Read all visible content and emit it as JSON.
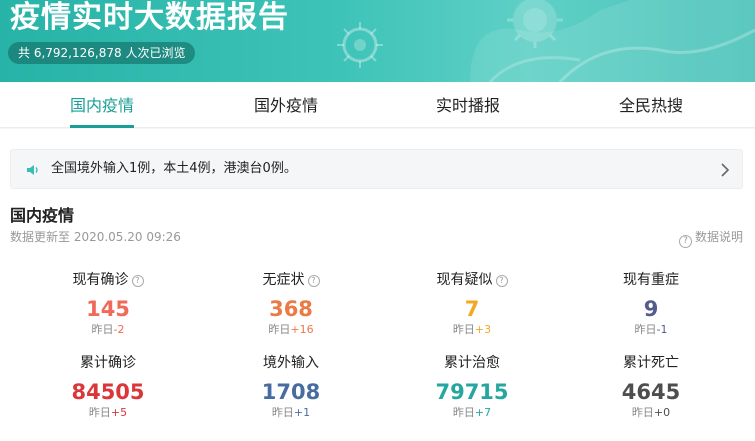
{
  "banner": {
    "title": "疫情实时大数据报告",
    "view_prefix": "共 ",
    "view_count": "6,792,126,878",
    "view_suffix": " 人次已浏览"
  },
  "tabs": [
    {
      "label": "国内疫情",
      "active": true
    },
    {
      "label": "国外疫情",
      "active": false
    },
    {
      "label": "实时播报",
      "active": false
    },
    {
      "label": "全民热搜",
      "active": false
    }
  ],
  "notice": {
    "icon": "speaker-icon",
    "text": "全国境外输入1例，本土4例，港澳台0例。"
  },
  "section": {
    "title": "国内疫情",
    "updated": "数据更新至 2020.05.20 09:26",
    "data_note": "数据说明"
  },
  "stats": [
    {
      "label": "现有确诊",
      "help": true,
      "value": "145",
      "delta_prefix": "昨日",
      "delta": "-2",
      "color": "#f06a5a",
      "delta_color": "#f06a5a"
    },
    {
      "label": "无症状",
      "help": true,
      "value": "368",
      "delta_prefix": "昨日",
      "delta": "+16",
      "color": "#ec7a45",
      "delta_color": "#ec7a45"
    },
    {
      "label": "现有疑似",
      "help": true,
      "value": "7",
      "delta_prefix": "昨日",
      "delta": "+3",
      "color": "#f5a623",
      "delta_color": "#f5a623"
    },
    {
      "label": "现有重症",
      "help": false,
      "value": "9",
      "delta_prefix": "昨日",
      "delta": "-1",
      "color": "#555b8c",
      "delta_color": "#555b8c"
    },
    {
      "label": "累计确诊",
      "help": false,
      "value": "84505",
      "delta_prefix": "昨日",
      "delta": "+5",
      "color": "#d9373a",
      "delta_color": "#d9373a"
    },
    {
      "label": "境外输入",
      "help": false,
      "value": "1708",
      "delta_prefix": "昨日",
      "delta": "+1",
      "color": "#476da0",
      "delta_color": "#476da0"
    },
    {
      "label": "累计治愈",
      "help": false,
      "value": "79715",
      "delta_prefix": "昨日",
      "delta": "+7",
      "color": "#25a6a0",
      "delta_color": "#25a6a0"
    },
    {
      "label": "累计死亡",
      "help": false,
      "value": "4645",
      "delta_prefix": "昨日",
      "delta": "+0",
      "color": "#4e4e4e",
      "delta_color": "#4e4e4e"
    }
  ]
}
